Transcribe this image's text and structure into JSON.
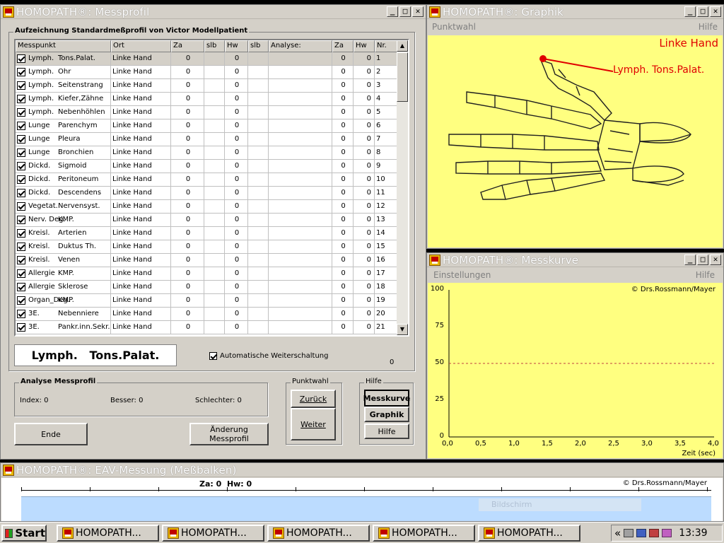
{
  "messprofil": {
    "title": "HOMOPATH®: Messprofil",
    "group_label": "Aufzeichnung Standardmeßprofil von  Victor Modellpatient",
    "columns": [
      "Messpunkt",
      "Ort",
      "Za",
      "slb",
      "Hw",
      "slb",
      "Analyse:",
      "Za",
      "Hw",
      "Nr."
    ],
    "rows": [
      {
        "p1": "Lymph.",
        "p2": "Tons.Palat.",
        "ort": "Linke Hand",
        "za": "0",
        "hw": "0",
        "za2": "0",
        "hw2": "0",
        "nr": "1"
      },
      {
        "p1": "Lymph.",
        "p2": "Ohr",
        "ort": "Linke Hand",
        "za": "0",
        "hw": "0",
        "za2": "0",
        "hw2": "0",
        "nr": "2"
      },
      {
        "p1": "Lymph.",
        "p2": "Seitenstrang",
        "ort": "Linke Hand",
        "za": "0",
        "hw": "0",
        "za2": "0",
        "hw2": "0",
        "nr": "3"
      },
      {
        "p1": "Lymph.",
        "p2": "Kiefer,Zähne",
        "ort": "Linke Hand",
        "za": "0",
        "hw": "0",
        "za2": "0",
        "hw2": "0",
        "nr": "4"
      },
      {
        "p1": "Lymph.",
        "p2": "Nebenhöhlen",
        "ort": "Linke Hand",
        "za": "0",
        "hw": "0",
        "za2": "0",
        "hw2": "0",
        "nr": "5"
      },
      {
        "p1": "Lunge",
        "p2": "Parenchym",
        "ort": "Linke Hand",
        "za": "0",
        "hw": "0",
        "za2": "0",
        "hw2": "0",
        "nr": "6"
      },
      {
        "p1": "Lunge",
        "p2": "Pleura",
        "ort": "Linke Hand",
        "za": "0",
        "hw": "0",
        "za2": "0",
        "hw2": "0",
        "nr": "7"
      },
      {
        "p1": "Lunge",
        "p2": "Bronchien",
        "ort": "Linke Hand",
        "za": "0",
        "hw": "0",
        "za2": "0",
        "hw2": "0",
        "nr": "8"
      },
      {
        "p1": "Dickd.",
        "p2": "Sigmoid",
        "ort": "Linke Hand",
        "za": "0",
        "hw": "0",
        "za2": "0",
        "hw2": "0",
        "nr": "9"
      },
      {
        "p1": "Dickd.",
        "p2": "Peritoneum",
        "ort": "Linke Hand",
        "za": "0",
        "hw": "0",
        "za2": "0",
        "hw2": "0",
        "nr": "10"
      },
      {
        "p1": "Dickd.",
        "p2": "Descendens",
        "ort": "Linke Hand",
        "za": "0",
        "hw": "0",
        "za2": "0",
        "hw2": "0",
        "nr": "11"
      },
      {
        "p1": "Vegetat.",
        "p2": "Nervensyst.",
        "ort": "Linke Hand",
        "za": "0",
        "hw": "0",
        "za2": "0",
        "hw2": "0",
        "nr": "12"
      },
      {
        "p1": "Nerv. Deg.",
        "p2": "KMP.",
        "ort": "Linke Hand",
        "za": "0",
        "hw": "0",
        "za2": "0",
        "hw2": "0",
        "nr": "13"
      },
      {
        "p1": "Kreisl.",
        "p2": "Arterien",
        "ort": "Linke Hand",
        "za": "0",
        "hw": "0",
        "za2": "0",
        "hw2": "0",
        "nr": "14"
      },
      {
        "p1": "Kreisl.",
        "p2": "Duktus Th.",
        "ort": "Linke Hand",
        "za": "0",
        "hw": "0",
        "za2": "0",
        "hw2": "0",
        "nr": "15"
      },
      {
        "p1": "Kreisl.",
        "p2": "Venen",
        "ort": "Linke Hand",
        "za": "0",
        "hw": "0",
        "za2": "0",
        "hw2": "0",
        "nr": "16"
      },
      {
        "p1": "Allergie",
        "p2": "KMP.",
        "ort": "Linke Hand",
        "za": "0",
        "hw": "0",
        "za2": "0",
        "hw2": "0",
        "nr": "17"
      },
      {
        "p1": "Allergie",
        "p2": "Sklerose",
        "ort": "Linke Hand",
        "za": "0",
        "hw": "0",
        "za2": "0",
        "hw2": "0",
        "nr": "18"
      },
      {
        "p1": "Organ_Deg.",
        "p2": "KMP.",
        "ort": "Linke Hand",
        "za": "0",
        "hw": "0",
        "za2": "0",
        "hw2": "0",
        "nr": "19"
      },
      {
        "p1": "3E.",
        "p2": "Nebenniere",
        "ort": "Linke Hand",
        "za": "0",
        "hw": "0",
        "za2": "0",
        "hw2": "0",
        "nr": "20"
      },
      {
        "p1": "3E.",
        "p2": "Pankr.inn.Sekr.",
        "ort": "Linke Hand",
        "za": "0",
        "hw": "0",
        "za2": "0",
        "hw2": "0",
        "nr": "21"
      }
    ],
    "current_point": "Lymph.   Tons.Palat.",
    "auto_label": "Automatische Weiterschaltung",
    "counter": "0",
    "analyse": {
      "label": "Analyse Messprofil",
      "index": "Index: 0",
      "besser": "Besser: 0",
      "schlechter": "Schlechter: 0"
    },
    "punktwahl": {
      "label": "Punktwahl",
      "zurueck": "Zurück",
      "weiter": "Weiter"
    },
    "hilfe": {
      "label": "Hilfe",
      "messkurve": "Messkurve",
      "graphik": "Graphik",
      "hilfe": "Hilfe"
    },
    "ende": "Ende",
    "aenderung": "Änderung Messprofil"
  },
  "graphik": {
    "title": "HOMOPATH®: Graphik",
    "menu_left": "Punktwahl",
    "menu_right": "Hilfe",
    "hand_label": "Linke Hand",
    "point_label": "Lymph. Tons.Palat."
  },
  "messkurve": {
    "title": "HOMOPATH®: Messkurve",
    "menu_left": "Einstellungen",
    "menu_right": "Hilfe",
    "copyright": "© Drs.Rossmann/Mayer",
    "y_ticks": [
      "100",
      "75",
      "50",
      "25",
      "0"
    ],
    "x_ticks": [
      "0,0",
      "0,5",
      "1,0",
      "1,5",
      "2,0",
      "2,5",
      "3,0",
      "3,5",
      "4,0"
    ],
    "x_label": "Zeit (sec)"
  },
  "eav": {
    "title": "HOMOPATH®: EAV-Messung (Meßbalken)",
    "za_hw": "Za: 0  Hw: 0",
    "copyright": "© Drs.Rossmann/Mayer",
    "ghost": "Bildschirm"
  },
  "taskbar": {
    "start": "Start",
    "items": [
      "HOMOPATH...",
      "HOMOPATH...",
      "HOMOPATH...",
      "HOMOPATH...",
      "HOMOPATH..."
    ],
    "chevron": "«",
    "clock": "13:39"
  },
  "colors": {
    "graph_bg": "#ffff80",
    "marker": "#e00000",
    "bar": "#bcdcff"
  }
}
